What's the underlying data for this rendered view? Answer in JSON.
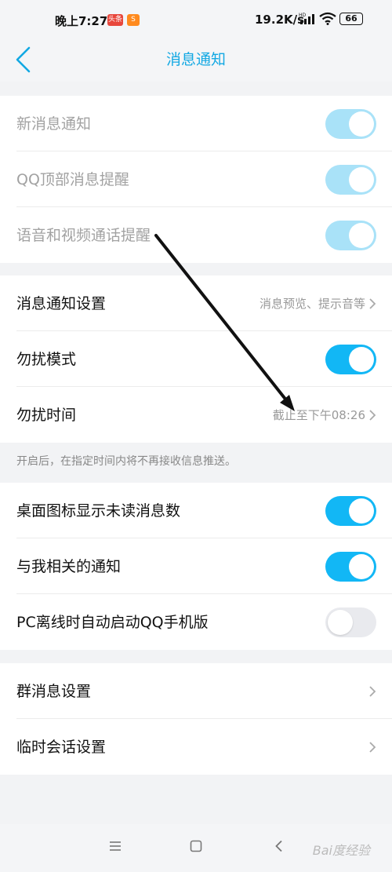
{
  "status_bar": {
    "time": "晚上7:27",
    "badge1": "头条",
    "net_speed": "19.2K/s",
    "battery": "66"
  },
  "nav": {
    "title": "消息通知"
  },
  "section1": [
    {
      "label": "新消息通知",
      "on": true,
      "disabled": true
    },
    {
      "label": "QQ顶部消息提醒",
      "on": true,
      "disabled": true
    },
    {
      "label": "语音和视频通话提醒",
      "on": true,
      "disabled": true
    }
  ],
  "section2": {
    "notify_settings": {
      "label": "消息通知设置",
      "value": "消息预览、提示音等"
    },
    "dnd_mode": {
      "label": "勿扰模式",
      "on": true
    },
    "dnd_time": {
      "label": "勿扰时间",
      "value": "截止至下午08:26"
    },
    "hint": "开启后，在指定时间内将不再接收信息推送。"
  },
  "section3": [
    {
      "label": "桌面图标显示未读消息数",
      "on": true
    },
    {
      "label": "与我相关的通知",
      "on": true
    },
    {
      "label": "PC离线时自动启动QQ手机版",
      "on": false
    }
  ],
  "section4": [
    {
      "label": "群消息设置"
    },
    {
      "label": "临时会话设置"
    }
  ],
  "watermark": "Bai度经验",
  "colors": {
    "accent": "#12b7f5",
    "accent_dim": "#a9e2f8",
    "title": "#12a8e3"
  }
}
